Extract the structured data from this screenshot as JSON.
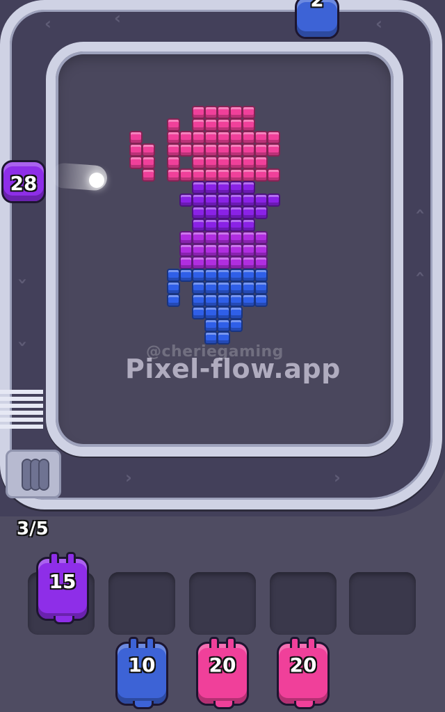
{
  "level_art": {
    "watermark_handle": "@cheriegaming",
    "watermark_site": "Pixel-flow.app"
  },
  "conveyor": {
    "queue_counter": "3/5"
  },
  "shooters_on_track": [
    {
      "count": "28",
      "color": "#8e2ee8"
    },
    {
      "count": "2",
      "color": "#3d63d6"
    }
  ],
  "waiting_slots": [
    {
      "count": "15",
      "color": "#8e2ee8"
    },
    {
      "count": "",
      "color": ""
    },
    {
      "count": "",
      "color": ""
    },
    {
      "count": "",
      "color": ""
    },
    {
      "count": "",
      "color": ""
    }
  ],
  "queue": [
    {
      "count": "10",
      "color": "#3d63d6"
    },
    {
      "count": "20",
      "color": "#f0409a"
    },
    {
      "count": "20",
      "color": "#f0409a"
    }
  ],
  "colors": {
    "pink": "#f0409a",
    "purple": "#8a22e6",
    "blue": "#2f5fe8",
    "rail": "#cfd2e4",
    "background": "#4f4c62"
  }
}
